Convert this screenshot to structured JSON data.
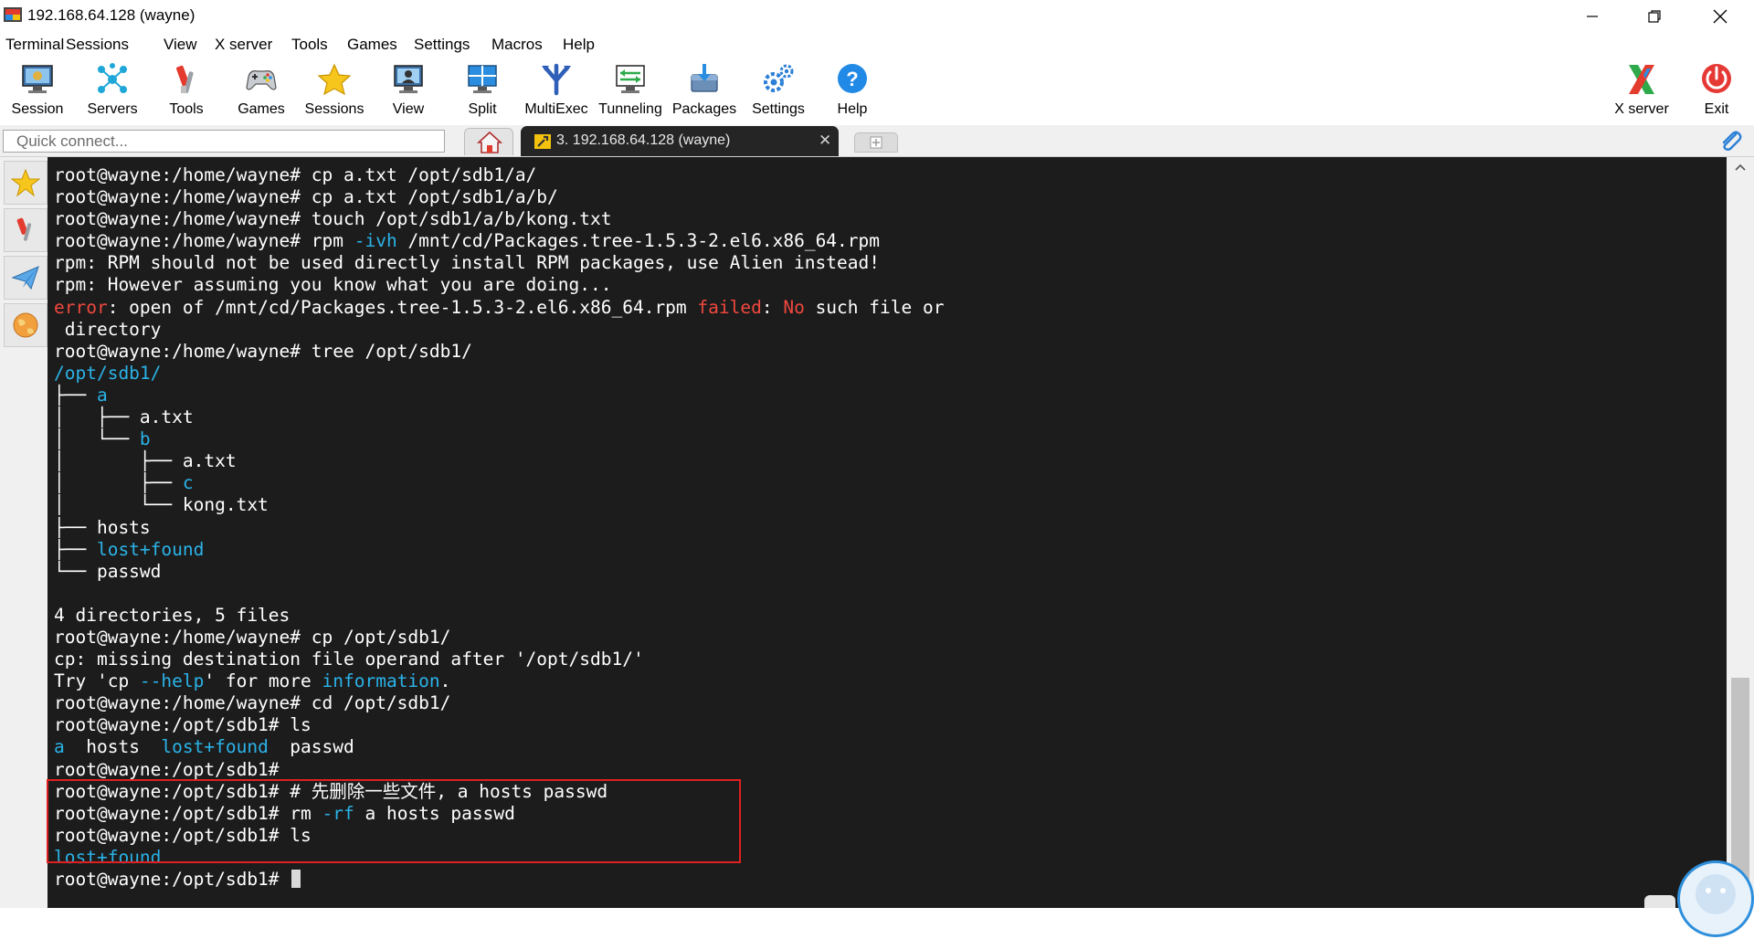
{
  "window": {
    "title": "192.168.64.128 (wayne)"
  },
  "menu": [
    "Terminal",
    "Sessions",
    "View",
    "X server",
    "Tools",
    "Games",
    "Settings",
    "Macros",
    "Help"
  ],
  "toolbar": {
    "left": [
      {
        "label": "Session",
        "icon": "monitor-session-icon"
      },
      {
        "label": "Servers",
        "icon": "servers-network-icon"
      },
      {
        "label": "Tools",
        "icon": "tools-icon"
      },
      {
        "label": "Games",
        "icon": "gamepad-icon"
      },
      {
        "label": "Sessions",
        "icon": "star-sessions-icon"
      },
      {
        "label": "View",
        "icon": "view-monitor-icon"
      },
      {
        "label": "Split",
        "icon": "split-screen-icon"
      },
      {
        "label": "MultiExec",
        "icon": "multiexec-fork-icon"
      },
      {
        "label": "Tunneling",
        "icon": "tunneling-icon"
      },
      {
        "label": "Packages",
        "icon": "packages-icon"
      },
      {
        "label": "Settings",
        "icon": "gears-settings-icon"
      },
      {
        "label": "Help",
        "icon": "help-question-icon"
      }
    ],
    "right": [
      {
        "label": "X server",
        "icon": "x-server-icon"
      },
      {
        "label": "Exit",
        "icon": "power-exit-icon"
      }
    ]
  },
  "tabs": {
    "quick_connect_placeholder": "Quick connect...",
    "active_tab_label": "3. 192.168.64.128 (wayne)",
    "close_glyph": "✕"
  },
  "terminal": {
    "lines": [
      [
        {
          "t": "root@wayne:/home/wayne# cp a.txt /opt/sdb1/a/"
        }
      ],
      [
        {
          "t": "root@wayne:/home/wayne# cp a.txt /opt/sdb1/a/b/"
        }
      ],
      [
        {
          "t": "root@wayne:/home/wayne# touch /opt/sdb1/a/b/kong.txt"
        }
      ],
      [
        {
          "t": "root@wayne:/home/wayne# rpm "
        },
        {
          "t": "-ivh",
          "c": "blue"
        },
        {
          "t": " /mnt/cd/Packages.tree-1.5.3-2.el6.x86_64.rpm"
        }
      ],
      [
        {
          "t": "rpm: RPM should not be used directly install RPM packages, use Alien instead!"
        }
      ],
      [
        {
          "t": "rpm: However assuming you know what you are doing..."
        }
      ],
      [
        {
          "t": "error",
          "c": "red"
        },
        {
          "t": ": open of /mnt/cd/Packages.tree-1.5.3-2.el6.x86_64.rpm "
        },
        {
          "t": "failed",
          "c": "red"
        },
        {
          "t": ": "
        },
        {
          "t": "No",
          "c": "red"
        },
        {
          "t": " such file or"
        }
      ],
      [
        {
          "t": " directory"
        }
      ],
      [
        {
          "t": "root@wayne:/home/wayne# tree /opt/sdb1/"
        }
      ],
      [
        {
          "t": "/opt/sdb1/",
          "c": "blue"
        }
      ],
      [
        {
          "t": "├── "
        },
        {
          "t": "a",
          "c": "blue"
        }
      ],
      [
        {
          "t": "│   ├── a.txt"
        }
      ],
      [
        {
          "t": "│   └── "
        },
        {
          "t": "b",
          "c": "blue"
        }
      ],
      [
        {
          "t": "│       ├── a.txt"
        }
      ],
      [
        {
          "t": "│       ├── "
        },
        {
          "t": "c",
          "c": "blue"
        }
      ],
      [
        {
          "t": "│       └── kong.txt"
        }
      ],
      [
        {
          "t": "├── hosts"
        }
      ],
      [
        {
          "t": "├── "
        },
        {
          "t": "lost+found",
          "c": "blue"
        }
      ],
      [
        {
          "t": "└── passwd"
        }
      ],
      [
        {
          "t": ""
        }
      ],
      [
        {
          "t": "4 directories, 5 files"
        }
      ],
      [
        {
          "t": "root@wayne:/home/wayne# cp /opt/sdb1/"
        }
      ],
      [
        {
          "t": "cp: missing destination file operand after '/opt/sdb1/'"
        }
      ],
      [
        {
          "t": "Try 'cp "
        },
        {
          "t": "--help",
          "c": "blue"
        },
        {
          "t": "' for more "
        },
        {
          "t": "information",
          "c": "blue"
        },
        {
          "t": "."
        }
      ],
      [
        {
          "t": "root@wayne:/home/wayne# cd /opt/sdb1/"
        }
      ],
      [
        {
          "t": "root@wayne:/opt/sdb1# ls"
        }
      ],
      [
        {
          "t": "a",
          "c": "blue"
        },
        {
          "t": "  hosts  "
        },
        {
          "t": "lost+found",
          "c": "blue"
        },
        {
          "t": "  passwd"
        }
      ],
      [
        {
          "t": "root@wayne:/opt/sdb1#"
        }
      ],
      [
        {
          "t": "root@wayne:/opt/sdb1# # 先删除一些文件, a hosts passwd"
        }
      ],
      [
        {
          "t": "root@wayne:/opt/sdb1# rm "
        },
        {
          "t": "-rf",
          "c": "blue"
        },
        {
          "t": " a hosts passwd"
        }
      ],
      [
        {
          "t": "root@wayne:/opt/sdb1# ls"
        }
      ],
      [
        {
          "t": "lost+found",
          "c": "blue"
        }
      ],
      [
        {
          "t": "root@wayne:/opt/sdb1# "
        }
      ]
    ],
    "colors": {
      "blue": "#2bb3e8",
      "red": "#f0483e",
      "fg": "#ffffff",
      "bg": "#1c1c1c"
    }
  }
}
